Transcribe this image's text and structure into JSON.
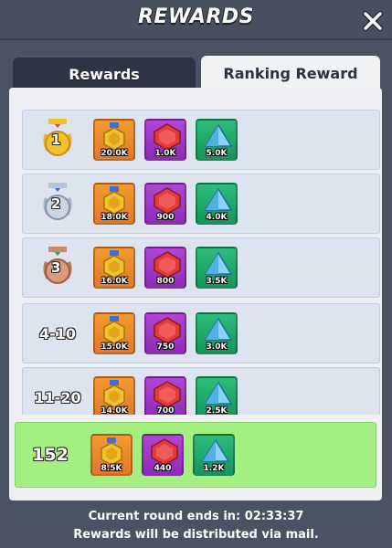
{
  "header": {
    "title": "REWARDS"
  },
  "tabs": [
    {
      "label": "Rewards"
    },
    {
      "label": "Ranking Reward"
    }
  ],
  "rows": [
    {
      "rank": "1",
      "badge": "20.0K",
      "gem": "1.0K",
      "crystal": "5.0K"
    },
    {
      "rank": "2",
      "badge": "18.0K",
      "gem": "900",
      "crystal": "4.0K"
    },
    {
      "rank": "3",
      "badge": "16.0K",
      "gem": "800",
      "crystal": "3.5K"
    },
    {
      "rank": "4-10",
      "badge": "15.0K",
      "gem": "750",
      "crystal": "3.0K"
    },
    {
      "rank": "11-20",
      "badge": "14.0K",
      "gem": "700",
      "crystal": "2.5K"
    }
  ],
  "my_row": {
    "rank": "152",
    "badge": "8.5K",
    "gem": "440",
    "crystal": "1.2K"
  },
  "footer": {
    "line1": "Current round ends in: 02:33:37",
    "line2": "Rewards will be distributed via mail."
  },
  "colors": {
    "gold": "#f2c12e",
    "silver": "#b9c4d4",
    "bronze": "#c98b6b",
    "my_row_bg": "#a3ef7f"
  }
}
